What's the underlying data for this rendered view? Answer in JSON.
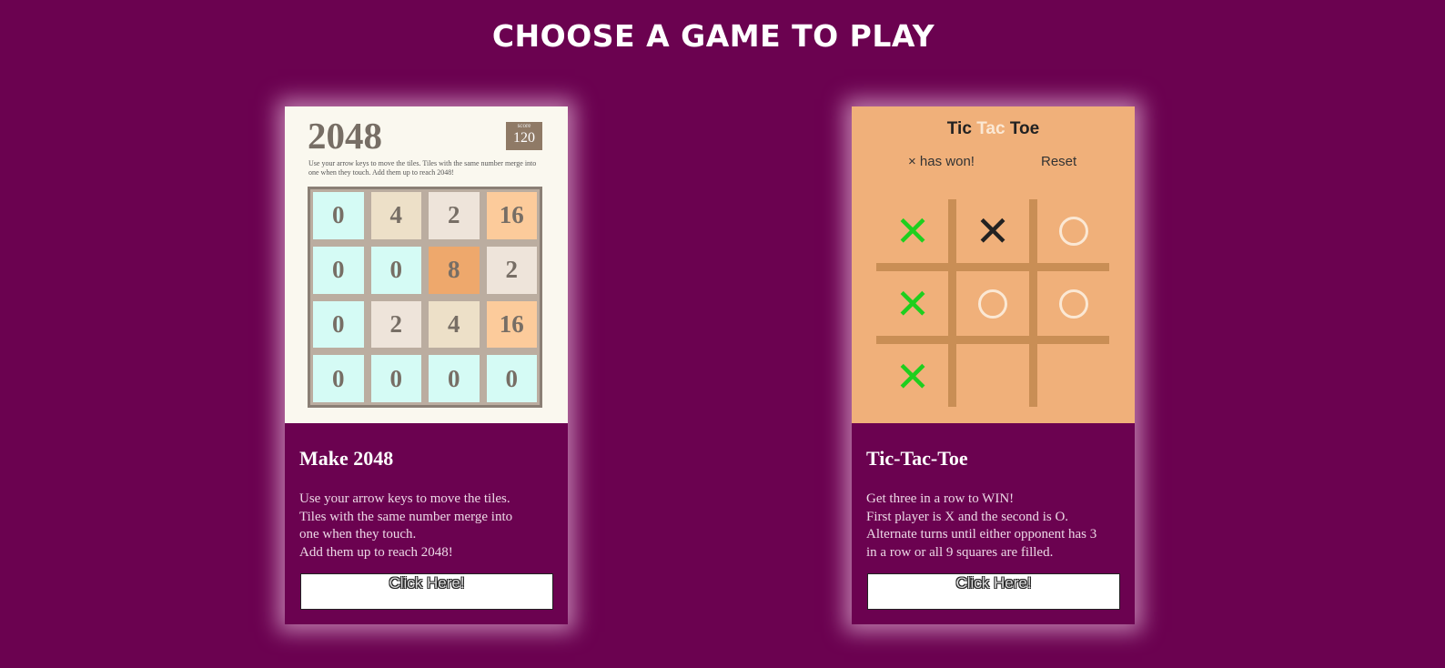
{
  "page_title": "CHOOSE A GAME TO PLAY",
  "cards": [
    {
      "title": "Make 2048",
      "desc": [
        "Use your arrow keys to move the tiles.",
        "Tiles with the same number merge into",
        "one when they touch.",
        "Add them up to reach 2048!"
      ],
      "button": "Click Here!",
      "preview": {
        "logo": "2048",
        "score_label": "score",
        "score": "120",
        "intro": "Use your arrow keys to move the tiles. Tiles with the same number merge into one when they touch. Add them up to reach 2048!",
        "tiles": [
          "0",
          "4",
          "2",
          "16",
          "0",
          "0",
          "8",
          "2",
          "0",
          "2",
          "4",
          "16",
          "0",
          "0",
          "0",
          "0"
        ]
      }
    },
    {
      "title": "Tic-Tac-Toe",
      "desc": [
        "Get three in a row to WIN!",
        "First player is X and the second is O.",
        "Alternate turns until either opponent has 3",
        "in a row or all 9 squares are filled."
      ],
      "button": "Click Here!",
      "preview": {
        "title_parts": [
          "Tic",
          "Tac",
          "Toe"
        ],
        "status": "× has won!",
        "reset": "Reset",
        "cells": [
          "X",
          "X",
          "O",
          "X",
          "O",
          "O",
          "X",
          "",
          ""
        ],
        "x_colors": [
          "#1ecf1e",
          "#222222",
          "",
          "#1ecf1e",
          "",
          "",
          "#1ecf1e",
          "",
          ""
        ]
      }
    }
  ],
  "tile_colors": {
    "0": "#d5fbf5",
    "2": "#eee4da",
    "4": "#ede0c8",
    "8": "#eea86c",
    "16": "#fccb9b"
  }
}
